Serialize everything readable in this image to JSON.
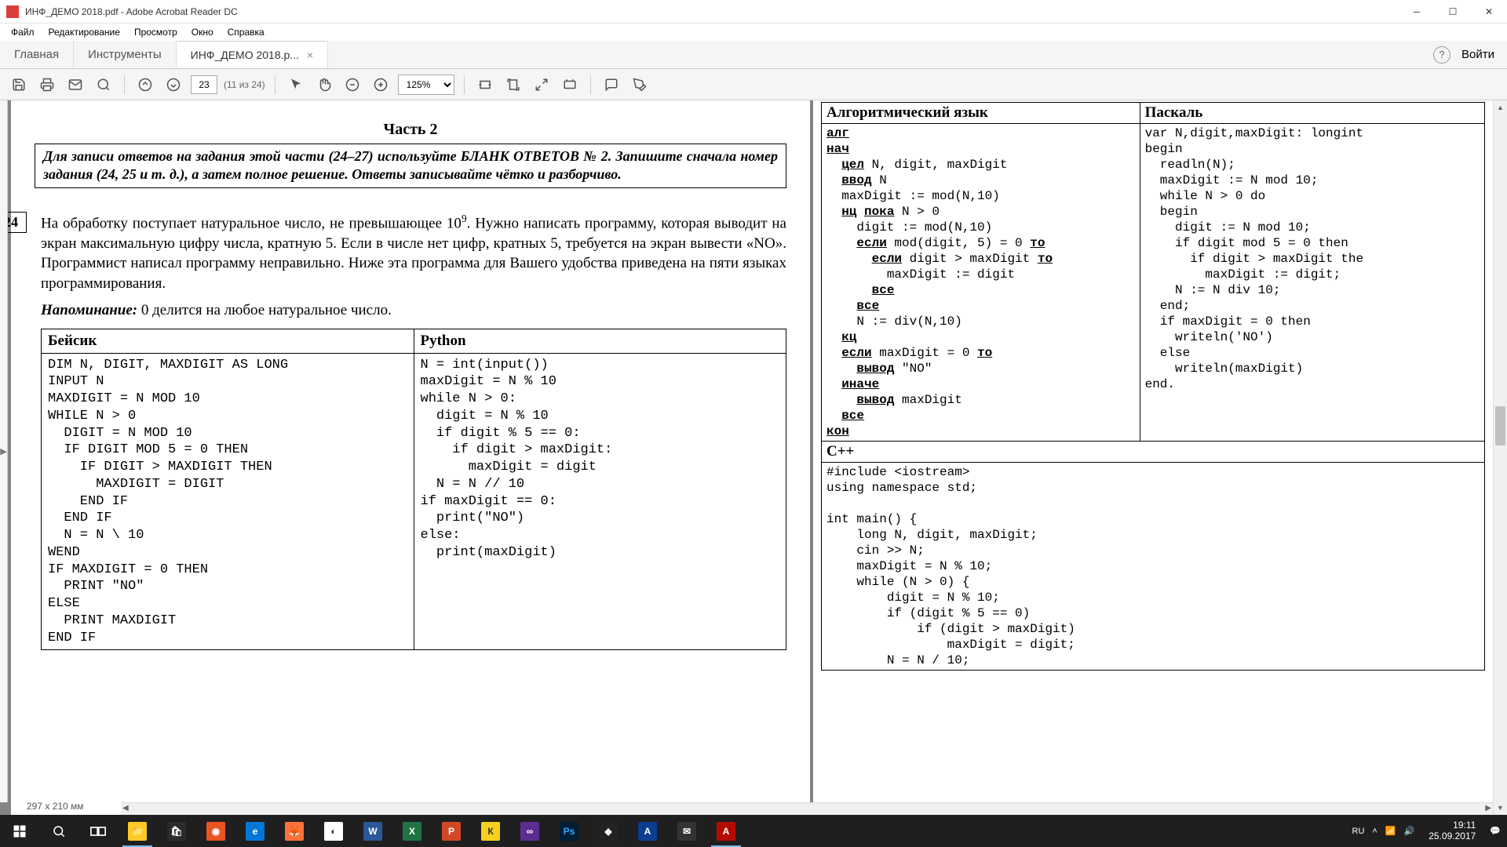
{
  "window": {
    "title": "ИНФ_ДЕМО 2018.pdf - Adobe Acrobat Reader DC"
  },
  "menu": {
    "file": "Файл",
    "edit": "Редактирование",
    "view": "Просмотр",
    "window": "Окно",
    "help": "Справка"
  },
  "tabs": {
    "home": "Главная",
    "tools": "Инструменты",
    "doc": "ИНФ_ДЕМО 2018.p...",
    "signin": "Войти"
  },
  "toolbar": {
    "page_current": "23",
    "page_total": "(11 из 24)",
    "zoom": "125%"
  },
  "doc_status": {
    "page_dims": "297 x 210 мм"
  },
  "content": {
    "part_title": "Часть 2",
    "instruction": "Для записи ответов на задания этой части (24–27) используйте БЛАНК ОТВЕТОВ № 2. Запишите сначала номер задания (24, 25 и т. д.), а затем полное решение. Ответы записывайте чётко и разборчиво.",
    "task_num": "24",
    "task_text_1": "На обработку поступает натуральное число, не превышающее 10",
    "task_sup": "9",
    "task_text_2": ". Нужно написать программу, которая выводит на экран максимальную цифру числа, кратную 5. Если в числе нет цифр, кратных 5, требуется на экран вывести «NO». Программист написал программу неправильно. Ниже эта программа для Вашего удобства приведена на пяти языках программирования.",
    "reminder_label": "Напоминание:",
    "reminder_text": " 0 делится на любое натуральное число.",
    "table": {
      "h_basic": "Бейсик",
      "h_python": "Python",
      "h_alg": "Алгоритмический язык",
      "h_pascal": "Паскаль",
      "h_cpp": "C++",
      "basic": "DIM N, DIGIT, MAXDIGIT AS LONG\nINPUT N\nMAXDIGIT = N MOD 10\nWHILE N > 0\n  DIGIT = N MOD 10\n  IF DIGIT MOD 5 = 0 THEN\n    IF DIGIT > MAXDIGIT THEN\n      MAXDIGIT = DIGIT\n    END IF\n  END IF\n  N = N \\ 10\nWEND\nIF MAXDIGIT = 0 THEN\n  PRINT \"NO\"\nELSE\n  PRINT MAXDIGIT\nEND IF",
      "python": "N = int(input())\nmaxDigit = N % 10\nwhile N > 0:\n  digit = N % 10\n  if digit % 5 == 0:\n    if digit > maxDigit:\n      maxDigit = digit\n  N = N // 10\nif maxDigit == 0:\n  print(\"NO\")\nelse:\n  print(maxDigit)",
      "pascal": "var N,digit,maxDigit: longint\nbegin\n  readln(N);\n  maxDigit := N mod 10;\n  while N > 0 do\n  begin\n    digit := N mod 10;\n    if digit mod 5 = 0 then\n      if digit > maxDigit the\n        maxDigit := digit;\n    N := N div 10;\n  end;\n  if maxDigit = 0 then\n    writeln('NO')\n  else\n    writeln(maxDigit)\nend.",
      "cpp": "#include <iostream>\nusing namespace std;\n\nint main() {\n    long N, digit, maxDigit;\n    cin >> N;\n    maxDigit = N % 10;\n    while (N > 0) {\n        digit = N % 10;\n        if (digit % 5 == 0)\n            if (digit > maxDigit)\n                maxDigit = digit;\n        N = N / 10;"
    }
  },
  "systray": {
    "lang": "RU",
    "time": "19:11",
    "date": "25.09.2017"
  }
}
